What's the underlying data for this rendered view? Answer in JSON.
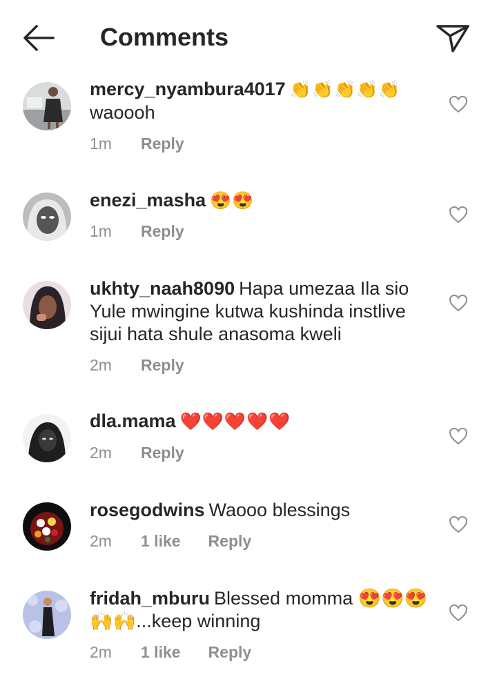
{
  "header": {
    "title": "Comments"
  },
  "comments": [
    {
      "username": "mercy_nyambura4017",
      "emojis": "👏👏👏👏👏",
      "text": "waoooh",
      "time": "1m",
      "likes": "",
      "reply": "Reply"
    },
    {
      "username": "enezi_masha",
      "emojis": "😍😍",
      "text": "",
      "time": "1m",
      "likes": "",
      "reply": "Reply"
    },
    {
      "username": "ukhty_naah8090",
      "emojis": "",
      "text": "Hapa umezaa Ila sio Yule mwingine kutwa kushinda instlive sijui hata shule anasoma kweli",
      "time": "2m",
      "likes": "",
      "reply": "Reply"
    },
    {
      "username": "dla.mama",
      "emojis": "❤️❤️❤️❤️❤️",
      "text": "",
      "time": "2m",
      "likes": "",
      "reply": "Reply"
    },
    {
      "username": "rosegodwins",
      "emojis": "",
      "text": "Waooo blessings",
      "time": "2m",
      "likes": "1 like",
      "reply": "Reply"
    },
    {
      "username": "fridah_mburu",
      "emojis": "",
      "text": "Blessed momma 😍😍😍🙌🙌...keep winning",
      "time": "2m",
      "likes": "1 like",
      "reply": "Reply"
    }
  ]
}
